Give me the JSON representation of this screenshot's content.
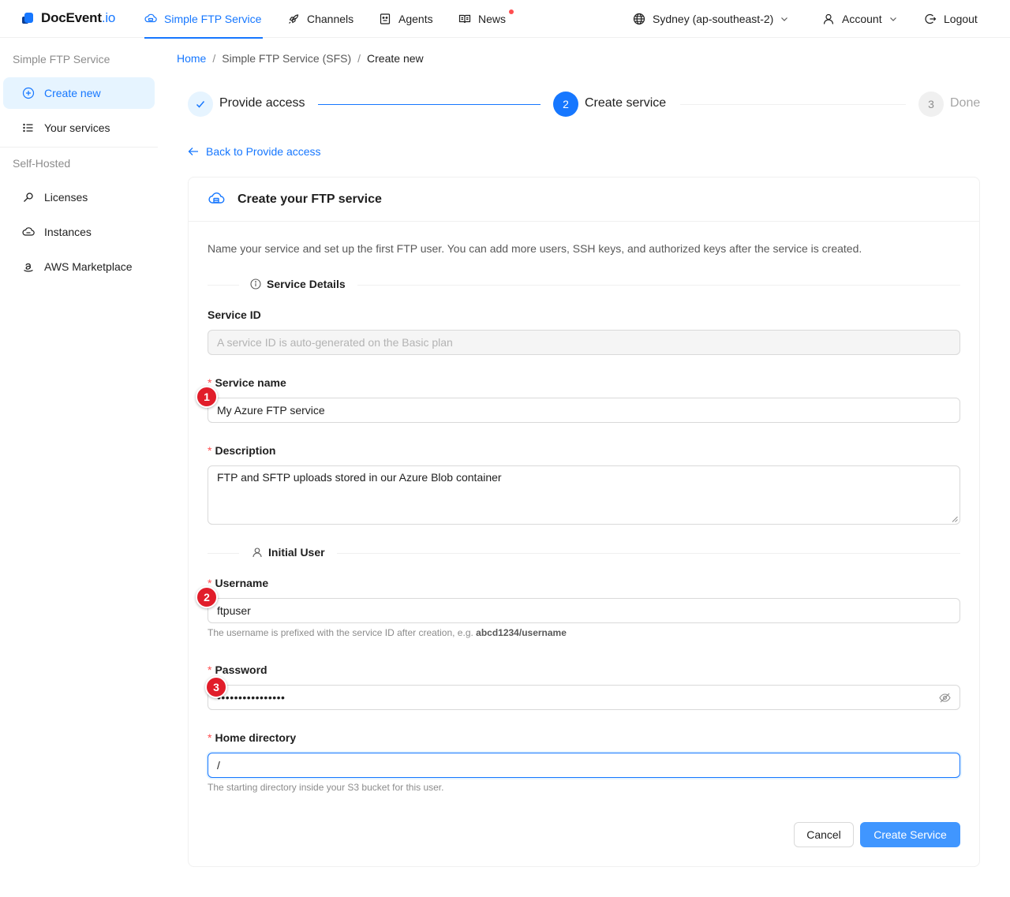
{
  "brand": {
    "name": "DocEvent",
    "suffix": ".io"
  },
  "topnav": {
    "items": [
      {
        "label": "Simple FTP Service",
        "icon": "cloud-server-icon",
        "active": true
      },
      {
        "label": "Channels",
        "icon": "rocket-icon"
      },
      {
        "label": "Agents",
        "icon": "robot-icon"
      },
      {
        "label": "News",
        "icon": "read-icon",
        "has_dot": true
      }
    ],
    "region": "Sydney (ap-southeast-2)",
    "account": "Account",
    "logout": "Logout"
  },
  "sidebar": {
    "groups": [
      {
        "title": "Simple FTP Service",
        "items": [
          {
            "label": "Create new",
            "icon": "plus-circle-icon",
            "active": true
          },
          {
            "label": "Your services",
            "icon": "list-icon"
          }
        ]
      },
      {
        "title": "Self-Hosted",
        "items": [
          {
            "label": "Licenses",
            "icon": "key-icon"
          },
          {
            "label": "Instances",
            "icon": "cloud-icon"
          },
          {
            "label": "AWS Marketplace",
            "icon": "amazon-icon"
          }
        ]
      }
    ]
  },
  "breadcrumb": {
    "home": "Home",
    "service": "Simple FTP Service (SFS)",
    "current": "Create new",
    "separator": "/"
  },
  "steps": [
    {
      "label": "Provide access",
      "status": "finish"
    },
    {
      "number": "2",
      "label": "Create service",
      "status": "process"
    },
    {
      "number": "3",
      "label": "Done",
      "status": "wait"
    }
  ],
  "back_link": "Back to Provide access",
  "card": {
    "title": "Create your FTP service",
    "intro": "Name your service and set up the first FTP user. You can add more users, SSH keys, and authorized keys after the service is created.",
    "section_service": "Service Details",
    "section_user": "Initial User",
    "fields": {
      "service_id": {
        "label": "Service ID",
        "placeholder": "A service ID is auto-generated on the Basic plan"
      },
      "service_name": {
        "label": "Service name",
        "value": "My Azure FTP service"
      },
      "description": {
        "label": "Description",
        "value": "FTP and SFTP uploads stored in our Azure Blob container"
      },
      "username": {
        "label": "Username",
        "value": "ftpuser",
        "help_prefix": "The username is prefixed with the service ID after creation, e.g. ",
        "help_example": "abcd1234/username"
      },
      "password": {
        "label": "Password",
        "masked": "••••••••••••••••"
      },
      "home_directory": {
        "label": "Home directory",
        "value": "/",
        "help": "The starting directory inside your S3 bucket for this user."
      }
    },
    "required_mark": "*",
    "cancel": "Cancel",
    "submit": "Create Service"
  },
  "annotations": [
    "1",
    "2",
    "3"
  ],
  "colors": {
    "primary": "#1677ff",
    "primary_button": "#4096ff",
    "badge": "#e11d2a",
    "required": "#ff4d4f"
  }
}
